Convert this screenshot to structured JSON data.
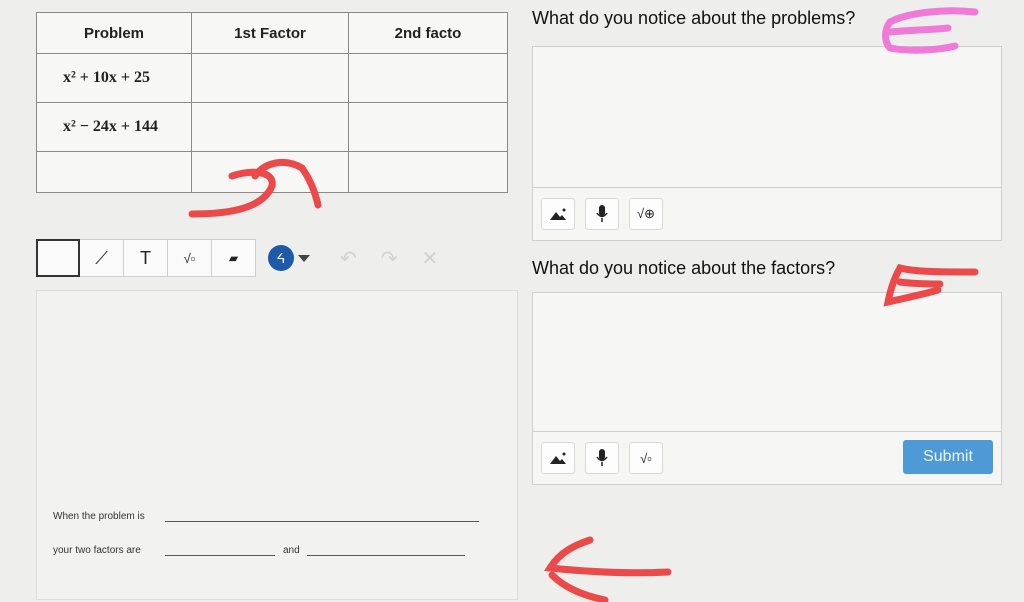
{
  "table": {
    "headers": [
      "Problem",
      "1st Factor",
      "2nd facto"
    ],
    "rows": [
      {
        "problem": "x² + 10x + 25",
        "factor1": "",
        "factor2": ""
      },
      {
        "problem": "x² − 24x + 144",
        "factor1": "",
        "factor2": ""
      },
      {
        "problem": "",
        "factor1": "",
        "factor2": ""
      }
    ]
  },
  "toolbar": {
    "tools": [
      {
        "name": "select-tool",
        "label": ""
      },
      {
        "name": "line-tool",
        "label": "⟋"
      },
      {
        "name": "text-tool",
        "label": "T"
      },
      {
        "name": "math-tool",
        "label": "√▫"
      },
      {
        "name": "eraser-tool",
        "label": "▰"
      }
    ],
    "undo": "↶",
    "redo": "↷",
    "clear": "✕"
  },
  "canvas": {
    "line1_prefix": "When the problem is",
    "line2_prefix": "your two factors are",
    "line2_joiner": "and"
  },
  "questions": [
    {
      "prompt": "What do you notice about the problems?"
    },
    {
      "prompt": "What do you notice about the factors?"
    }
  ],
  "submit_label": "Submit",
  "colors": {
    "accent": "#1e5aa8",
    "submit": "#4d9ad6",
    "annotation_red": "#ec4a4a",
    "annotation_pink": "#f07ad8"
  }
}
